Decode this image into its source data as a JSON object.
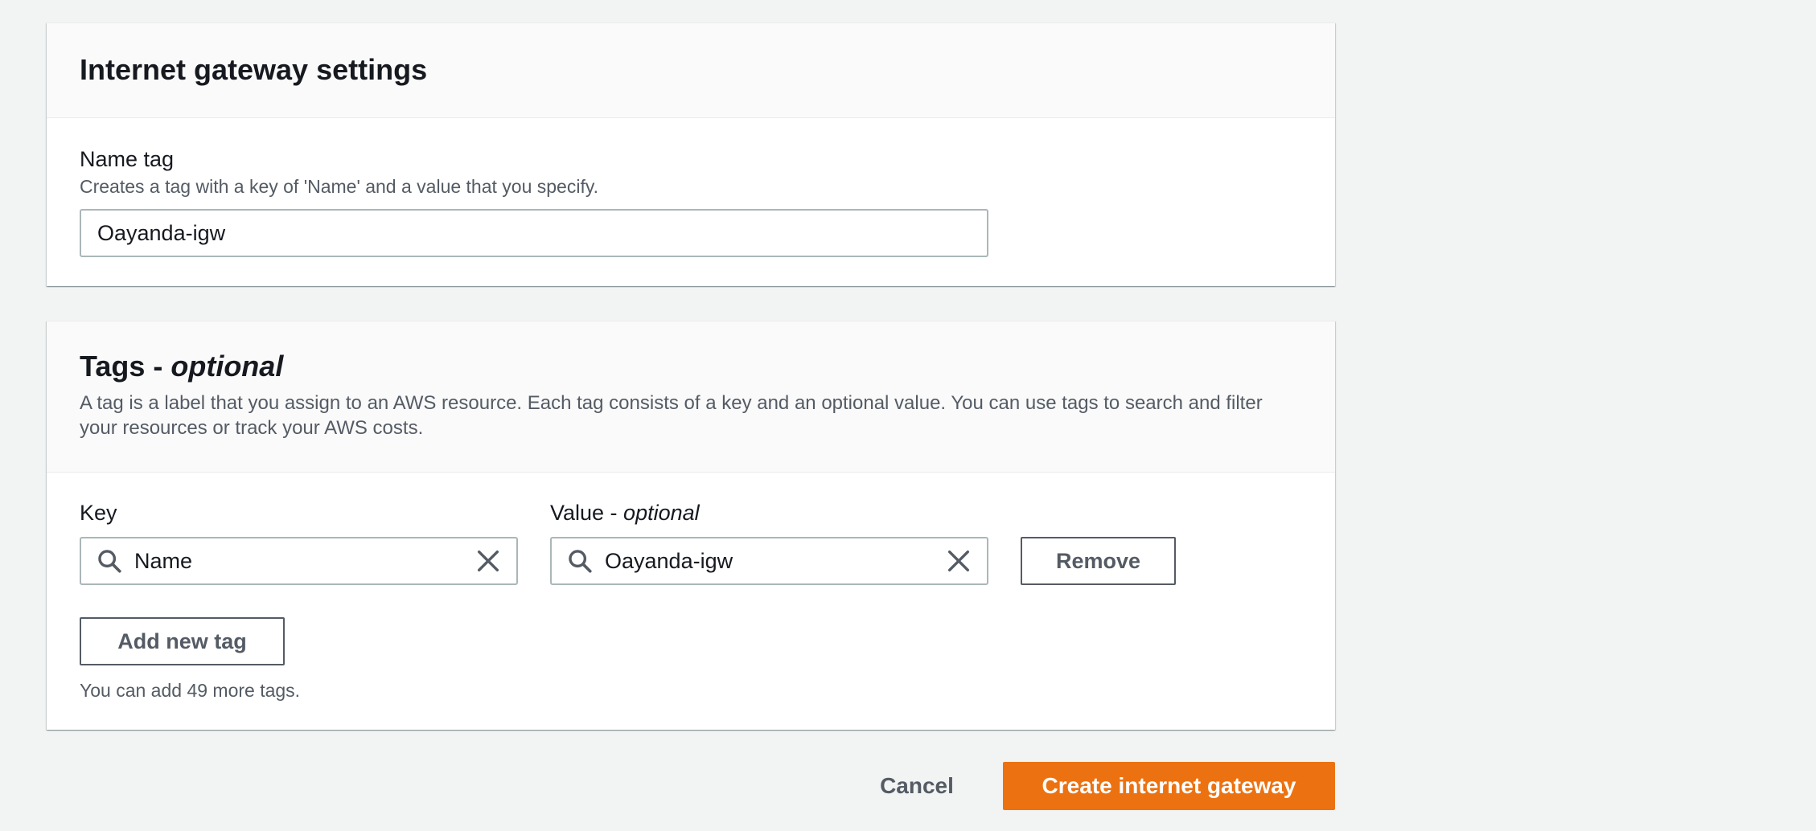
{
  "gateway_settings": {
    "title": "Internet gateway settings",
    "name_tag": {
      "label": "Name tag",
      "description": "Creates a tag with a key of 'Name' and a value that you specify.",
      "value": "Oayanda-igw"
    }
  },
  "tags": {
    "title_main": "Tags - ",
    "title_optional": "optional",
    "description": "A tag is a label that you assign to an AWS resource. Each tag consists of a key and an optional value. You can use tags to search and filter your resources or track your AWS costs.",
    "key_label": "Key",
    "value_label_main": "Value - ",
    "value_label_optional": "optional",
    "rows": [
      {
        "key": "Name",
        "value": "Oayanda-igw"
      }
    ],
    "remove_label": "Remove",
    "add_label": "Add new tag",
    "limit_text": "You can add 49 more tags."
  },
  "actions": {
    "cancel_label": "Cancel",
    "create_label": "Create internet gateway"
  },
  "colors": {
    "primary": "#ec7211",
    "page_bg": "#f2f3f3",
    "secondary_text": "#545b64"
  },
  "icons": {
    "search": "search-icon",
    "clear": "close-icon"
  }
}
